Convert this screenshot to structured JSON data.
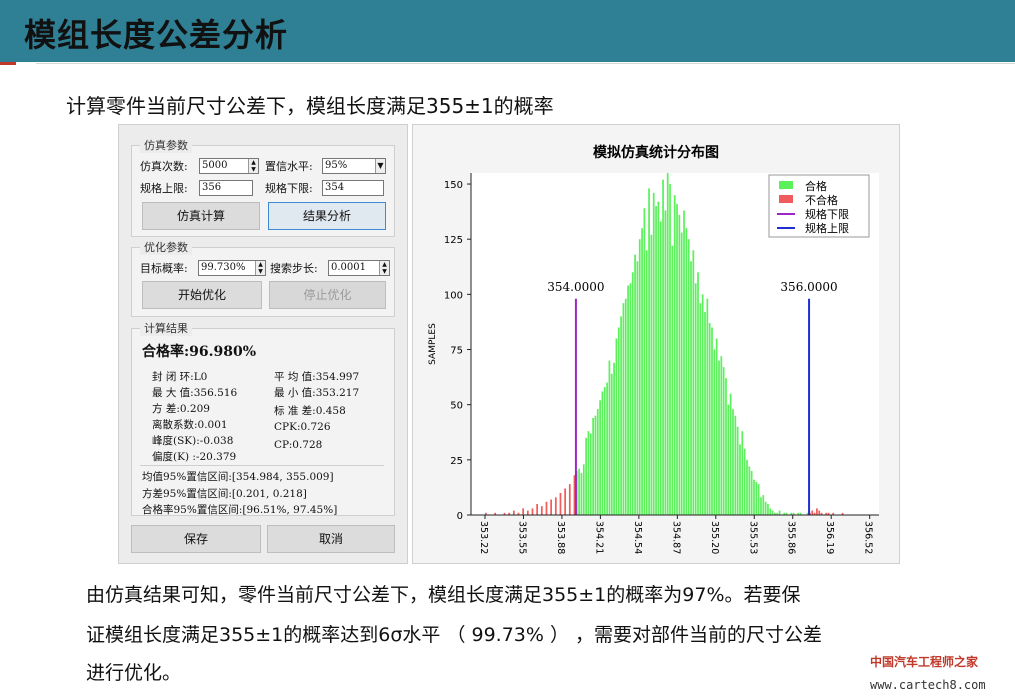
{
  "header": {
    "title": "模组长度公差分析"
  },
  "subtitle": "计算零件当前尺寸公差下，模组长度满足355±1的概率",
  "panel": {
    "sim_group": {
      "title": "仿真参数",
      "sim_count_label": "仿真次数:",
      "sim_count_value": "5000",
      "confidence_label": "置信水平:",
      "confidence_value": "95%",
      "upper_label": "规格上限:",
      "upper_value": "356",
      "lower_label": "规格下限:",
      "lower_value": "354",
      "sim_button": "仿真计算",
      "analysis_button": "结果分析"
    },
    "opt_group": {
      "title": "优化参数",
      "target_label": "目标概率:",
      "target_value": "99.730%",
      "step_label": "搜索步长:",
      "step_value": "0.0001",
      "start_button": "开始优化",
      "stop_button": "停止优化"
    },
    "result_group": {
      "title": "计算结果",
      "pass_rate": "合格率:96.980%",
      "left": [
        "封 闭 环:L0",
        "最 大 值:356.516",
        "方    差:0.209",
        "离散系数:0.001",
        "峰度(SK):-0.038",
        "偏度(K) :-20.379"
      ],
      "right": [
        "平 均 值:354.997",
        "最 小 值:353.217",
        "标 准 差:0.458",
        "CPK:0.726",
        "CP:0.728"
      ],
      "ci": [
        "均值95%置信区间:[354.984, 355.009]",
        "方差95%置信区间:[0.201, 0.218]",
        "合格率95%置信区间:[96.51%, 97.45%]"
      ]
    },
    "save_button": "保存",
    "cancel_button": "取消"
  },
  "paragraph": [
    "由仿真结果可知，零件当前尺寸公差下，模组长度满足355±1的概率为97%。若要保",
    "证模组长度满足355±1的概率达到6σ水平 （ 99.73% ） ，需要对部件当前的尺寸公差",
    "进行优化。"
  ],
  "footer": {
    "brand": "中国汽车工程师之家",
    "url": "www.cartech8.com"
  },
  "chart_data": {
    "type": "bar",
    "title": "模拟仿真统计分布图",
    "ylabel": "SAMPLES",
    "xlabel": "",
    "xlim": [
      353.1,
      356.6
    ],
    "ylim": [
      0,
      155
    ],
    "yticks": [
      0,
      25,
      50,
      75,
      100,
      125,
      150
    ],
    "xticks": [
      "353.22",
      "353.55",
      "353.88",
      "354.21",
      "354.54",
      "354.87",
      "355.20",
      "355.53",
      "355.86",
      "356.19",
      "356.52"
    ],
    "xtick_values": [
      353.22,
      353.55,
      353.88,
      354.21,
      354.54,
      354.87,
      355.2,
      355.53,
      355.86,
      356.19,
      356.52
    ],
    "lower_limit": 354.0,
    "lower_limit_label": "354.0000",
    "upper_limit": 356.0,
    "upper_limit_label": "356.0000",
    "legend": [
      "合格",
      "不合格",
      "规格下限",
      "规格上限"
    ],
    "legend_position": "top-right",
    "colors": {
      "pass": "#5cf05c",
      "fail": "#f25b5b",
      "lower": "#9c27c8",
      "upper": "#1f2fd0"
    },
    "series": [
      {
        "bin_width": 0.02,
        "x": [
          353.23,
          353.27,
          353.31,
          353.35,
          353.39,
          353.43,
          353.47,
          353.51,
          353.55,
          353.59,
          353.63,
          353.67,
          353.71,
          353.75,
          353.79,
          353.83,
          353.87,
          353.91,
          353.95,
          353.99,
          354.01,
          354.03,
          354.05,
          354.07,
          354.09,
          354.11,
          354.13,
          354.15,
          354.17,
          354.19,
          354.21,
          354.23,
          354.25,
          354.27,
          354.29,
          354.31,
          354.33,
          354.35,
          354.37,
          354.39,
          354.41,
          354.43,
          354.45,
          354.47,
          354.49,
          354.51,
          354.53,
          354.55,
          354.57,
          354.59,
          354.61,
          354.63,
          354.65,
          354.67,
          354.69,
          354.71,
          354.73,
          354.75,
          354.77,
          354.79,
          354.81,
          354.83,
          354.85,
          354.87,
          354.89,
          354.91,
          354.93,
          354.95,
          354.97,
          354.99,
          355.01,
          355.03,
          355.05,
          355.07,
          355.09,
          355.11,
          355.13,
          355.15,
          355.17,
          355.19,
          355.21,
          355.23,
          355.25,
          355.27,
          355.29,
          355.31,
          355.33,
          355.35,
          355.37,
          355.39,
          355.41,
          355.43,
          355.45,
          355.47,
          355.49,
          355.51,
          355.53,
          355.55,
          355.57,
          355.59,
          355.61,
          355.63,
          355.65,
          355.67,
          355.69,
          355.71,
          355.73,
          355.75,
          355.77,
          355.79,
          355.81,
          355.83,
          355.85,
          355.87,
          355.89,
          355.91,
          355.93,
          355.95,
          355.97,
          355.99,
          356.01,
          356.03,
          356.05,
          356.07,
          356.09,
          356.11,
          356.13,
          356.15,
          356.17,
          356.19,
          356.21,
          356.25,
          356.29,
          356.33
        ],
        "y": [
          1,
          0,
          1,
          0,
          1,
          1,
          2,
          1,
          3,
          2,
          3,
          5,
          4,
          6,
          7,
          8,
          10,
          12,
          14,
          18,
          20,
          21,
          19,
          23,
          35,
          38,
          37,
          44,
          45,
          48,
          52,
          56,
          58,
          60,
          70,
          64,
          69,
          80,
          85,
          90,
          96,
          98,
          104,
          105,
          110,
          118,
          115,
          125,
          130,
          139,
          120,
          148,
          127,
          146,
          140,
          142,
          133,
          152,
          138,
          155,
          150,
          122,
          145,
          141,
          136,
          128,
          138,
          130,
          125,
          115,
          120,
          105,
          110,
          96,
          100,
          92,
          98,
          87,
          85,
          75,
          80,
          70,
          72,
          67,
          62,
          50,
          55,
          48,
          45,
          40,
          32,
          38,
          30,
          25,
          22,
          20,
          16,
          15,
          14,
          8,
          9,
          6,
          5,
          3,
          2,
          1,
          1,
          2,
          0,
          1,
          1,
          0,
          1,
          1,
          0,
          1,
          1,
          0,
          0,
          1,
          1,
          2,
          1,
          3,
          2,
          1,
          0,
          1,
          1,
          0,
          1,
          0,
          1,
          0
        ]
      }
    ]
  }
}
